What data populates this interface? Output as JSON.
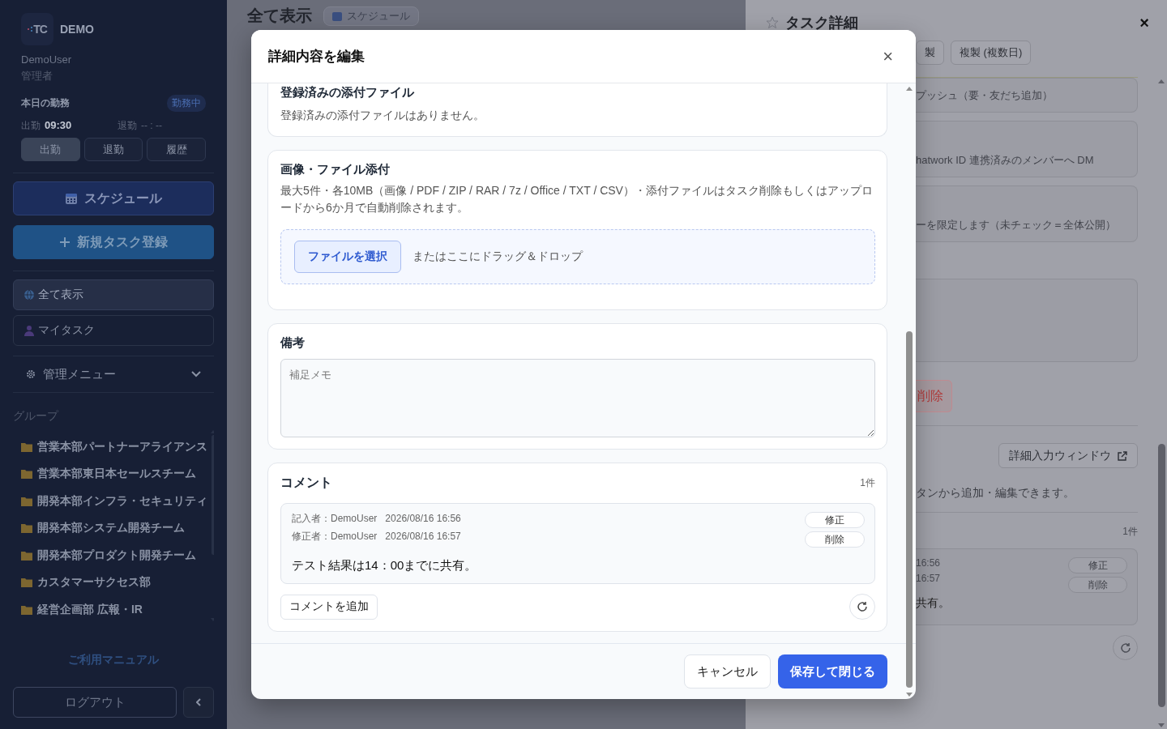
{
  "sidebar": {
    "logo": {
      "mark": "TC",
      "label": "DEMO"
    },
    "user": {
      "name": "DemoUser",
      "role": "管理者"
    },
    "attendance": {
      "title": "本日の勤務",
      "status": "勤務中",
      "clock_in_label": "出勤",
      "clock_in_time": "09:30",
      "clock_out_label": "退勤",
      "clock_out_time": "-- : --",
      "buttons": [
        {
          "label": "出勤",
          "disabled": true
        },
        {
          "label": "退勤",
          "disabled": false
        },
        {
          "label": "履歴",
          "disabled": false
        }
      ]
    },
    "schedule_button": "スケジュール",
    "new_task_button": "新規タスク登録",
    "nav": [
      {
        "label": "全て表示",
        "selected": true
      },
      {
        "label": "マイタスク",
        "selected": false
      }
    ],
    "admin_menu": {
      "label": "管理メニュー",
      "expanded": false
    },
    "groups": {
      "title": "グループ",
      "items": [
        "営業本部パートナーアライアンス",
        "営業本部東日本セールスチーム",
        "開発本部インフラ・セキュリティ",
        "開発本部システム開発チーム",
        "開発本部プロダクト開発チーム",
        "カスタマーサクセス部",
        "経営企画部 広報・IR"
      ]
    },
    "manual_link": "ご利用マニュアル",
    "logout_button": "ログアウト"
  },
  "main": {
    "title": "全て表示",
    "chip": "スケジュール"
  },
  "task_panel": {
    "title": "タスク詳細",
    "starred": false,
    "close": "×",
    "buttons": [
      "製",
      "複製 (複数日)"
    ],
    "fields": [
      "プッシュ（要・友だち追加）",
      "hatwork ID 連携済みのメンバーへ DM",
      "ーを限定します（未チェック＝全体公開）"
    ],
    "delete_button": "削除",
    "detail_window_button": "詳細入力ウィンドウ",
    "hint": "タンから追加・編集できます。",
    "comment_count": "1件",
    "comment": {
      "created": "16:56",
      "edited": "16:57",
      "text": "共有。",
      "edit_button": "修正",
      "delete_button": "削除"
    }
  },
  "modal": {
    "title": "詳細内容を編集",
    "close": "×",
    "sections": [
      {
        "kind": "attachments",
        "title": "登録済みの添付ファイル",
        "text": "登録済みの添付ファイルはありません。"
      },
      {
        "kind": "upload",
        "title": "画像・ファイル添付",
        "text": "最大5件・各10MB（画像 / PDF / ZIP / RAR / 7z / Office / TXT / CSV）・添付ファイルはタスク削除もしくはアップロードから6か月で自動削除されます。",
        "button": "ファイルを選択",
        "hint": "またはここにドラッグ＆ドロップ"
      },
      {
        "kind": "note",
        "title": "備考",
        "placeholder": "補足メモ"
      },
      {
        "kind": "comments",
        "title": "コメント",
        "count": "1件",
        "comments": [
          {
            "author": "記入者：DemoUser",
            "created_at": "2026/08/16 16:56",
            "editor": "修正者：DemoUser",
            "edited_at": "2026/08/16 16:57",
            "text": "テスト結果は14：00までに共有。",
            "edit_button": "修正",
            "delete_button": "削除"
          }
        ],
        "add_button": "コメントを追加"
      }
    ],
    "cancel_button": "キャンセル",
    "save_button": "保存して閉じる"
  }
}
